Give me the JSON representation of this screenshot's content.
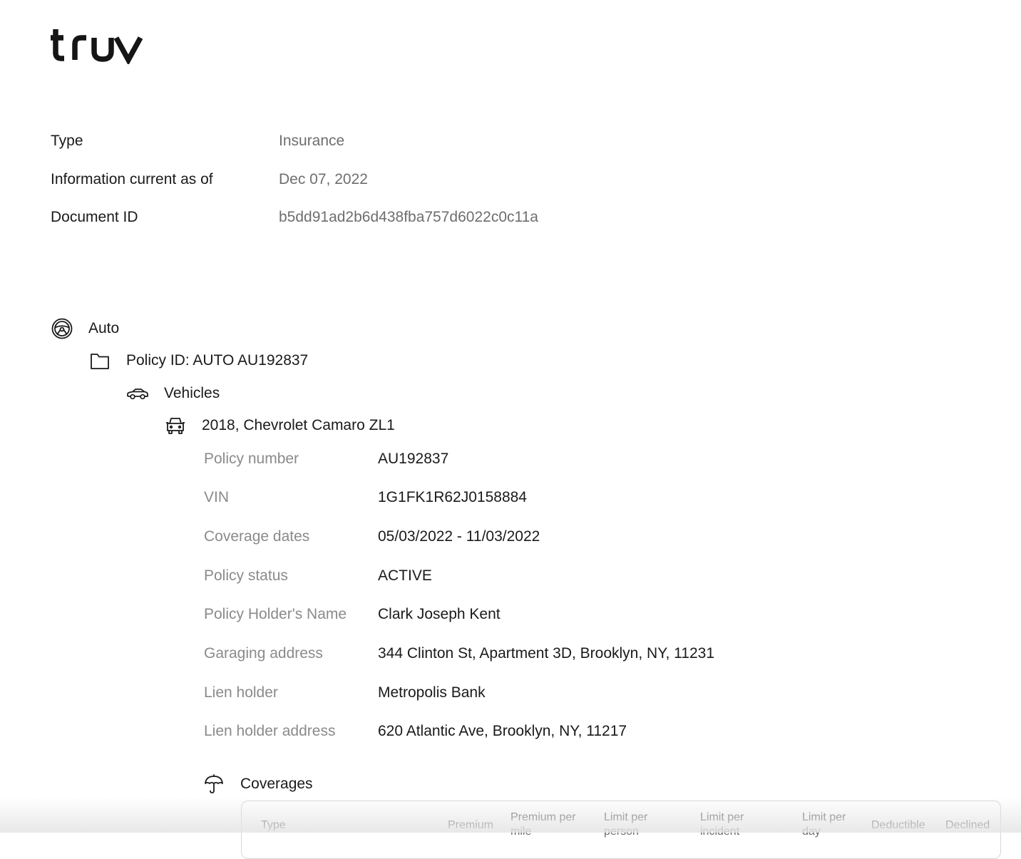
{
  "brand": {
    "logo_text": "truv"
  },
  "meta": [
    {
      "label": "Type",
      "value": "Insurance"
    },
    {
      "label": "Information current as of",
      "value": "Dec 07, 2022"
    },
    {
      "label": "Document ID",
      "value": "b5dd91ad2b6d438fba757d6022c0c11a"
    }
  ],
  "tree": {
    "category": {
      "label": "Auto",
      "icon": "steering-wheel-icon"
    },
    "policy": {
      "label": "Policy ID: AUTO AU192837",
      "icon": "folder-icon"
    },
    "vehicles": {
      "label": "Vehicles",
      "icon": "car-side-icon"
    },
    "vehicle": {
      "label": "2018, Chevrolet Camaro ZL1",
      "icon": "car-front-icon"
    }
  },
  "vehicle_details": [
    {
      "label": "Policy number",
      "value": "AU192837"
    },
    {
      "label": "VIN",
      "value": "1G1FK1R62J0158884"
    },
    {
      "label": "Coverage dates",
      "value": "05/03/2022 - 11/03/2022"
    },
    {
      "label": "Policy status",
      "value": "ACTIVE"
    },
    {
      "label": "Policy Holder's Name",
      "value": "Clark Joseph Kent"
    },
    {
      "label": "Garaging address",
      "value": "344 Clinton St, Apartment 3D, Brooklyn, NY, 11231"
    },
    {
      "label": "Lien holder",
      "value": "Metropolis Bank"
    },
    {
      "label": "Lien holder address",
      "value": "620 Atlantic Ave, Brooklyn, NY, 11217"
    }
  ],
  "coverages": {
    "label": "Coverages",
    "icon": "umbrella-icon",
    "columns": [
      {
        "l1": "Type",
        "l2": ""
      },
      {
        "l1": "Premium",
        "l2": ""
      },
      {
        "l1": "Premium per",
        "l2": "mile"
      },
      {
        "l1": "Limit per",
        "l2": "person"
      },
      {
        "l1": "Limit per",
        "l2": "incident"
      },
      {
        "l1": "Limit per",
        "l2": "day"
      },
      {
        "l1": "Deductible",
        "l2": ""
      },
      {
        "l1": "Declined",
        "l2": ""
      }
    ]
  }
}
